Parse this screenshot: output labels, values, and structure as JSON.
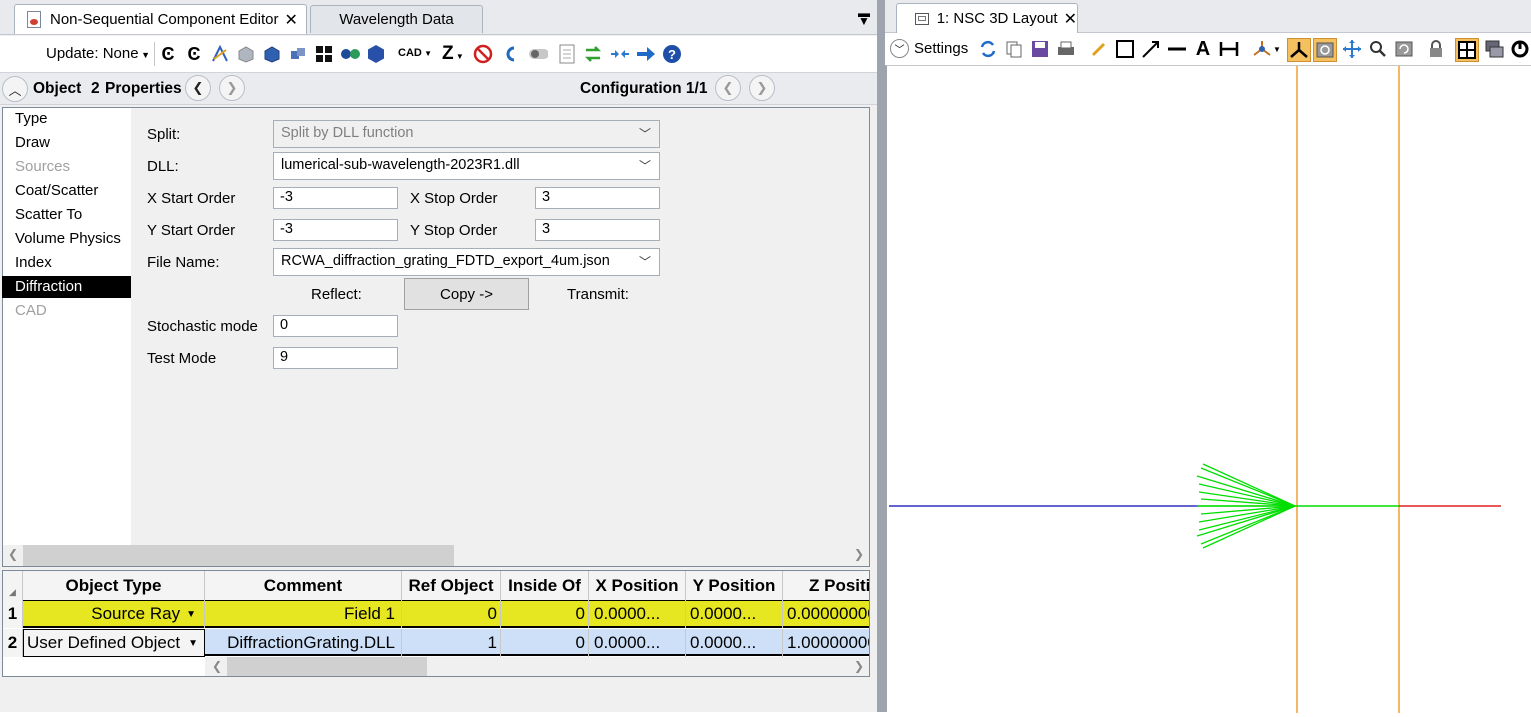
{
  "tabs": {
    "nsc_editor": "Non-Sequential Component Editor",
    "wavelength": "Wavelength Data",
    "layout": "1: NSC 3D Layout"
  },
  "toolbar": {
    "update_label": "Update: None",
    "cad_label": "CAD",
    "z_label": "Z",
    "settings_label": "Settings"
  },
  "props_header": {
    "object_label": "Object",
    "object_num": "2",
    "properties_label": "Properties",
    "config_label": "Configuration 1/1"
  },
  "categories": [
    "Type",
    "Draw",
    "Sources",
    "Coat/Scatter",
    "Scatter To",
    "Volume Physics",
    "Index",
    "Diffraction",
    "CAD"
  ],
  "form": {
    "split_label": "Split:",
    "split_value": "Split by DLL function",
    "dll_label": "DLL:",
    "dll_value": "lumerical-sub-wavelength-2023R1.dll",
    "x_start_label": "X Start Order",
    "x_start_value": "-3",
    "x_stop_label": "X Stop Order",
    "x_stop_value": "3",
    "y_start_label": "Y Start Order",
    "y_start_value": "-3",
    "y_stop_label": "Y Stop Order",
    "y_stop_value": "3",
    "file_label": "File Name:",
    "file_value": "RCWA_diffraction_grating_FDTD_export_4um.json",
    "reflect_label": "Reflect:",
    "copy_label": "Copy ->",
    "transmit_label": "Transmit:",
    "stochastic_label": "Stochastic mode",
    "stochastic_value": "0",
    "test_label": "Test Mode",
    "test_value": "9"
  },
  "table": {
    "headers": [
      "Object Type",
      "Comment",
      "Ref Object",
      "Inside Of",
      "X Position",
      "Y Position",
      "Z Positi"
    ],
    "rows": [
      {
        "num": "1",
        "type": "Source Ray",
        "comment": "Field 1",
        "ref": "0",
        "inside": "0",
        "x": "0.0000...",
        "y": "0.0000...",
        "z": "0.00000000"
      },
      {
        "num": "2",
        "type": "User Defined Object",
        "comment": "DiffractionGrating.DLL",
        "ref": "1",
        "inside": "0",
        "x": "0.0000...",
        "y": "0.0000...",
        "z": "1.00000000"
      }
    ]
  },
  "colors": {
    "selected_row": "#e6e621",
    "row2": "#cde0f7",
    "ray": "#00dd00",
    "axis_blue": "#3030c0",
    "axis_red": "#e02020",
    "orange": "#f0a030"
  }
}
